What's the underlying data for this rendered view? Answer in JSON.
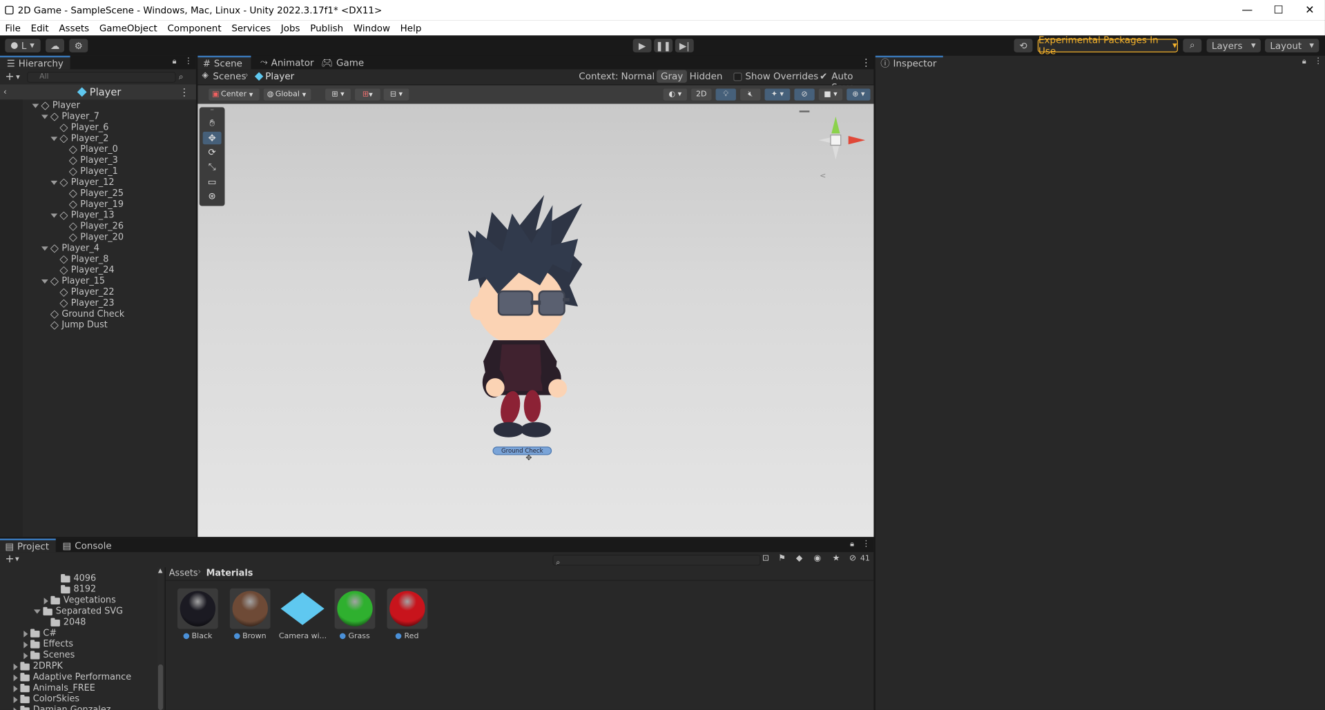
{
  "window": {
    "title": "2D Game - SampleScene - Windows, Mac, Linux - Unity 2022.3.17f1* <DX11>",
    "minimize_glyph": "—",
    "maximize_glyph": "☐",
    "close_glyph": "✕"
  },
  "menu": [
    "File",
    "Edit",
    "Assets",
    "GameObject",
    "Component",
    "Services",
    "Jobs",
    "Publish",
    "Window",
    "Help"
  ],
  "toolbar": {
    "account_label": "L",
    "experimental_label": "Experimental Packages In Use",
    "layers_label": "Layers",
    "layout_label": "Layout"
  },
  "hierarchy": {
    "tab_label": "Hierarchy",
    "search_placeholder": "All",
    "header_label": "Player",
    "rows": [
      {
        "label": "Player",
        "depth": 0,
        "expanded": true
      },
      {
        "label": "Player_7",
        "depth": 1,
        "expanded": true
      },
      {
        "label": "Player_6",
        "depth": 2,
        "expanded": null
      },
      {
        "label": "Player_2",
        "depth": 2,
        "expanded": true
      },
      {
        "label": "Player_0",
        "depth": 3,
        "expanded": null
      },
      {
        "label": "Player_3",
        "depth": 3,
        "expanded": null
      },
      {
        "label": "Player_1",
        "depth": 3,
        "expanded": null
      },
      {
        "label": "Player_12",
        "depth": 2,
        "expanded": true
      },
      {
        "label": "Player_25",
        "depth": 3,
        "expanded": null
      },
      {
        "label": "Player_19",
        "depth": 3,
        "expanded": null
      },
      {
        "label": "Player_13",
        "depth": 2,
        "expanded": true
      },
      {
        "label": "Player_26",
        "depth": 3,
        "expanded": null
      },
      {
        "label": "Player_20",
        "depth": 3,
        "expanded": null
      },
      {
        "label": "Player_4",
        "depth": 1,
        "expanded": true
      },
      {
        "label": "Player_8",
        "depth": 2,
        "expanded": null
      },
      {
        "label": "Player_24",
        "depth": 2,
        "expanded": null
      },
      {
        "label": "Player_15",
        "depth": 1,
        "expanded": true
      },
      {
        "label": "Player_22",
        "depth": 2,
        "expanded": null
      },
      {
        "label": "Player_23",
        "depth": 2,
        "expanded": null
      },
      {
        "label": "Ground Check",
        "depth": 1,
        "expanded": null
      },
      {
        "label": "Jump Dust",
        "depth": 1,
        "expanded": null
      }
    ]
  },
  "scene": {
    "tabs": [
      "Scene",
      "Animator",
      "Game"
    ],
    "breadcrumb": [
      "Scenes",
      "Player"
    ],
    "context_label": "Context:",
    "context_modes": [
      "Normal",
      "Gray",
      "Hidden"
    ],
    "show_overrides_label": "Show Overrides",
    "auto_save_label": "Auto Save",
    "pivot_label": "Center",
    "space_label": "Global",
    "mode_2d_label": "2D",
    "ground_check_label": "Ground Check"
  },
  "inspector": {
    "tab_label": "Inspector"
  },
  "project": {
    "tabs": [
      "Project",
      "Console"
    ],
    "hidden_count": "41",
    "breadcrumb": [
      "Assets",
      "Materials"
    ],
    "tree": [
      {
        "label": "4096",
        "depth": 3,
        "arrow": "none"
      },
      {
        "label": "8192",
        "depth": 3,
        "arrow": "none"
      },
      {
        "label": "Vegetations",
        "depth": 2,
        "arrow": "right"
      },
      {
        "label": "Separated SVG",
        "depth": 1,
        "arrow": "down"
      },
      {
        "label": "2048",
        "depth": 2,
        "arrow": "none"
      },
      {
        "label": "C#",
        "depth": 0,
        "arrow": "right"
      },
      {
        "label": "Effects",
        "depth": 0,
        "arrow": "right"
      },
      {
        "label": "Scenes",
        "depth": 0,
        "arrow": "right"
      },
      {
        "label": "2DRPK",
        "depth": -1,
        "arrow": "right"
      },
      {
        "label": "Adaptive Performance",
        "depth": -1,
        "arrow": "right"
      },
      {
        "label": "Animals_FREE",
        "depth": -1,
        "arrow": "right"
      },
      {
        "label": "ColorSkies",
        "depth": -1,
        "arrow": "right"
      },
      {
        "label": "Damian Gonzalez",
        "depth": -1,
        "arrow": "right"
      }
    ],
    "assets": [
      {
        "label": "Black",
        "kind": "material",
        "color": "#1b1a22"
      },
      {
        "label": "Brown",
        "kind": "material",
        "color": "#6e4a36"
      },
      {
        "label": "Camera wi...",
        "kind": "prefab",
        "color": "#5fc8f0"
      },
      {
        "label": "Grass",
        "kind": "material",
        "color": "#2fb02f"
      },
      {
        "label": "Red",
        "kind": "material",
        "color": "#c8141c"
      }
    ]
  },
  "colors": {
    "accent": "#3a79bb",
    "panel": "#282828",
    "viewport": "#d4d4d4",
    "experimental": "#f3b12b"
  }
}
